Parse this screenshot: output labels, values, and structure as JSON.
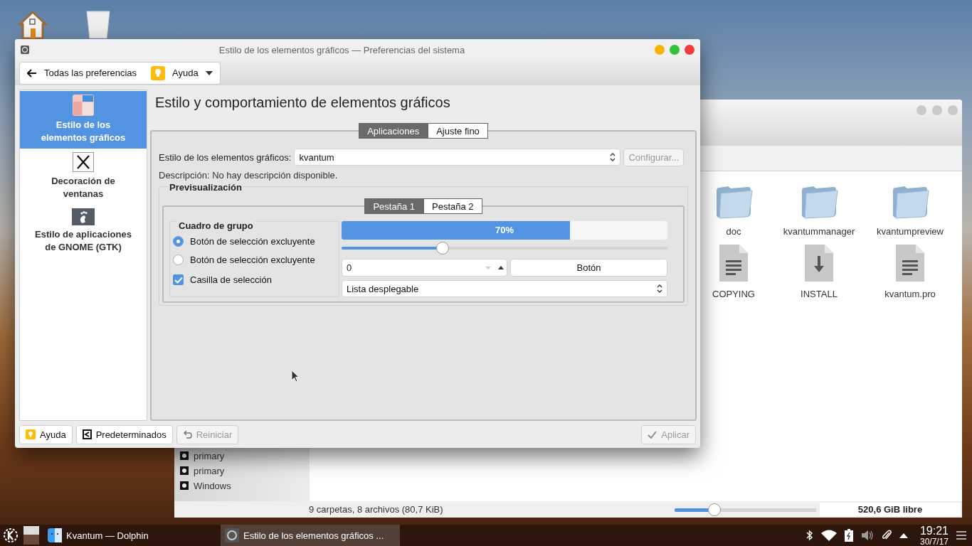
{
  "file_manager": {
    "places": [
      {
        "label": "primary"
      },
      {
        "label": "primary"
      },
      {
        "label": "Windows"
      }
    ],
    "files": [
      {
        "name": "doc",
        "kind": "folder"
      },
      {
        "name": "kvantummanager",
        "kind": "folder"
      },
      {
        "name": "kvantumpreview",
        "kind": "folder"
      },
      {
        "name": "COPYING",
        "kind": "text"
      },
      {
        "name": "INSTALL",
        "kind": "install"
      },
      {
        "name": "kvantum.pro",
        "kind": "text"
      }
    ],
    "status": "9 carpetas, 8 archivos (80,7 KiB)",
    "zoom": {
      "level": 0.28
    },
    "free_space": "520,6 GiB libre"
  },
  "settings": {
    "window": {
      "title": "Estilo de los elementos gráficos — Preferencias del sistema"
    },
    "toolbar": {
      "back": "Todas las preferencias",
      "help": "Ayuda"
    },
    "sidebar": {
      "items": [
        {
          "label": "Estilo de los elementos gráficos",
          "kind": "widgets",
          "selected": true
        },
        {
          "label": "Decoración de ventanas",
          "kind": "x11",
          "selected": false
        },
        {
          "label": "Estilo de aplicaciones de GNOME (GTK)",
          "kind": "gnome",
          "selected": false
        }
      ]
    },
    "page_title": "Estilo y comportamiento de elementos gráficos",
    "tabs": [
      {
        "label": "Aplicaciones",
        "selected": true
      },
      {
        "label": "Ajuste fino",
        "selected": false
      }
    ],
    "style_field": {
      "label": "Estilo de los elementos gráficos:",
      "value": "kvantum"
    },
    "configure_button": {
      "label": "Configurar...",
      "disabled": true
    },
    "description": "Descripción: No hay descripción disponible.",
    "preview": {
      "title": "Previsualización",
      "tabs": [
        {
          "label": "Pestaña 1",
          "selected": true
        },
        {
          "label": "Pestaña 2",
          "selected": false
        }
      ],
      "group_box": {
        "title": "Cuadro de grupo",
        "radios": [
          {
            "label": "Botón de selección excluyente",
            "selected": true
          },
          {
            "label": "Botón de selección excluyente",
            "selected": false
          }
        ],
        "checkbox": {
          "label": "Casilla de selección",
          "checked": true
        }
      },
      "progress": {
        "level": 0.7,
        "label": "70%"
      },
      "slider": {
        "level": 0.31
      },
      "spin_box": {
        "value": "0"
      },
      "button": "Botón",
      "combo": {
        "value": "Lista desplegable"
      }
    },
    "buttons": [
      {
        "label": "Ayuda",
        "kind": "help",
        "disabled": false
      },
      {
        "label": "Predeterminados",
        "kind": "defaults",
        "disabled": false
      },
      {
        "label": "Reiniciar",
        "kind": "reset",
        "disabled": true
      },
      {
        "label": "Aplicar",
        "kind": "apply",
        "disabled": true
      }
    ]
  },
  "taskbar": {
    "tasks": [
      {
        "label": "Kvantum — Dolphin",
        "kind": "dolphin",
        "selected": false
      },
      {
        "label": "Estilo de los elementos gráficos ...",
        "kind": "settings",
        "selected": true
      }
    ],
    "clock": {
      "time": "19:21",
      "date": "30/7/17"
    }
  }
}
